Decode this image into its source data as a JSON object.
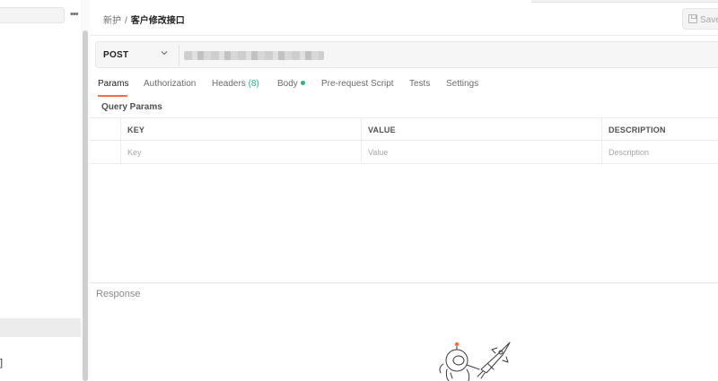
{
  "sidebar": {
    "more_label": "•••",
    "bracket_text": "]"
  },
  "breadcrumb": {
    "parent": "新护",
    "separator": "/",
    "current": "客户修改接口"
  },
  "toolbar": {
    "save_label": "Save"
  },
  "request": {
    "method": "POST",
    "url": ""
  },
  "tabs": [
    {
      "label": "Params"
    },
    {
      "label": "Authorization"
    },
    {
      "label": "Headers",
      "count": "(8)"
    },
    {
      "label": "Body"
    },
    {
      "label": "Pre-request Script"
    },
    {
      "label": "Tests"
    },
    {
      "label": "Settings"
    }
  ],
  "params": {
    "title": "Query Params",
    "headers": [
      "KEY",
      "VALUE",
      "DESCRIPTION"
    ],
    "placeholders": [
      "Key",
      "Value",
      "Description"
    ]
  },
  "response": {
    "title": "Response"
  },
  "colors": {
    "accent": "#ff6c37",
    "status_green": "#26b47f"
  }
}
